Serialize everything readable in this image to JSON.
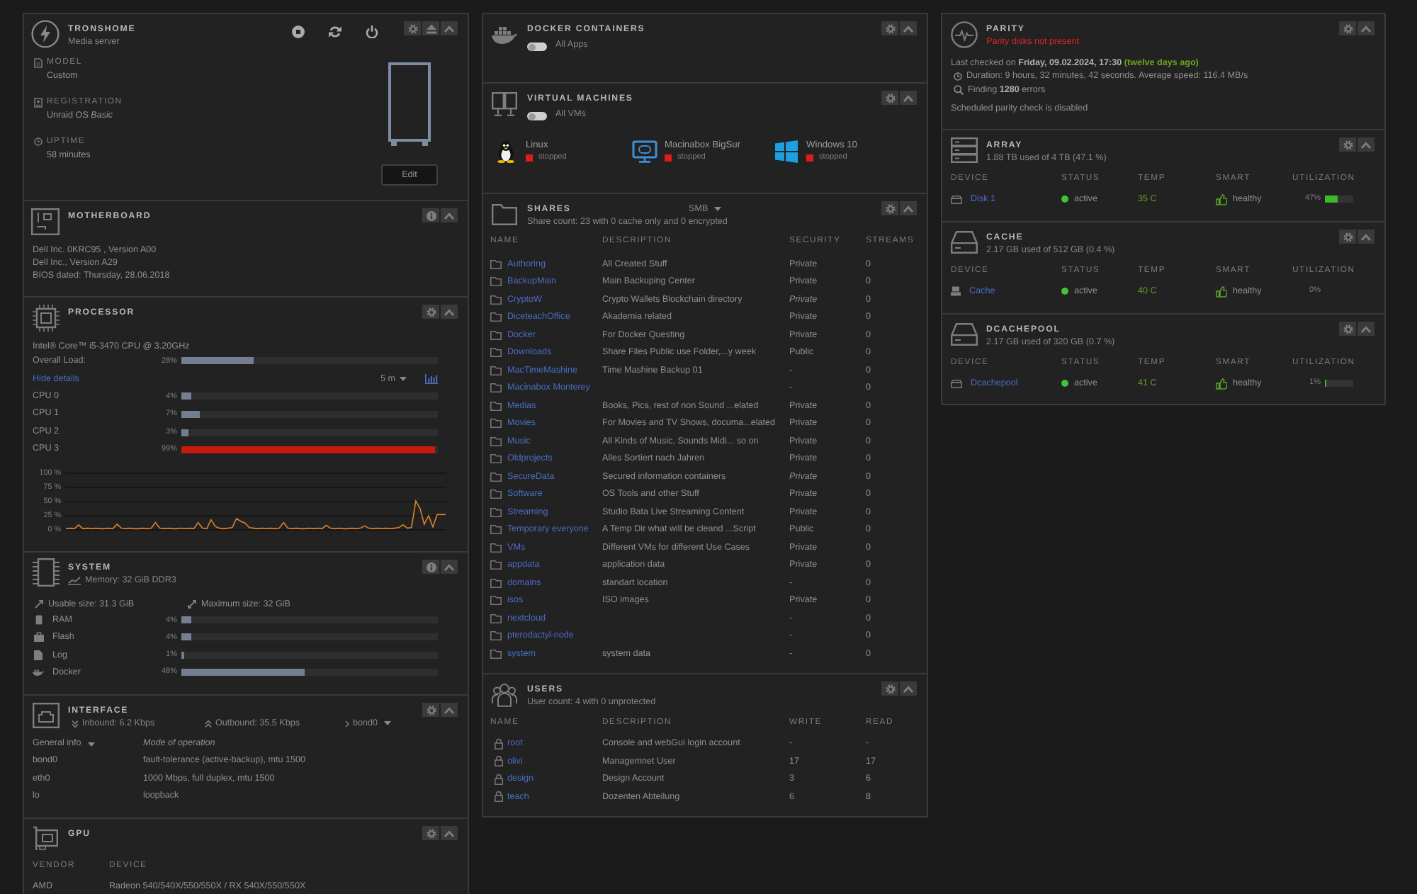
{
  "server": {
    "name": "TRONSHOME",
    "description": "Media server",
    "fields": [
      {
        "label": "MODEL",
        "value": "Custom"
      },
      {
        "label": "REGISTRATION",
        "value": "Unraid OS *Basic*"
      },
      {
        "label": "UPTIME",
        "value": "58 minutes"
      }
    ],
    "edit_button": "Edit"
  },
  "motherboard": {
    "title": "MOTHERBOARD",
    "lines": [
      "Dell Inc. 0KRC95 , Version A00",
      "Dell Inc., Version A29",
      "BIOS dated: Thursday, 28.06.2018"
    ]
  },
  "processor": {
    "title": "PROCESSOR",
    "model": "Intel® Core™ i5-3470 CPU @ 3.20GHz",
    "overall": {
      "label": "Overall Load:",
      "reading": "28%",
      "level": 0.28
    },
    "details_link": "Hide details",
    "interval": "5 m",
    "cores": [
      {
        "label": "CPU 0",
        "reading": "4%",
        "level": 0.04
      },
      {
        "label": "CPU 1",
        "reading": "7%",
        "level": 0.07
      },
      {
        "label": "CPU 2",
        "reading": "3%",
        "level": 0.03
      },
      {
        "label": "CPU 3",
        "reading": "99%",
        "level": 0.99
      }
    ],
    "chart_data": {
      "type": "line",
      "grid": true,
      "ylim": [
        0,
        100
      ],
      "yticks": [
        {
          "value": 100,
          "label": "100 %"
        },
        {
          "value": 75,
          "label": "75 %"
        },
        {
          "value": 50,
          "label": "50 %"
        },
        {
          "value": 25,
          "label": "25 %"
        },
        {
          "value": 0,
          "label": "0 %"
        }
      ],
      "series": [
        {
          "color": "#d9822b",
          "values": [
            2,
            3,
            2,
            9,
            2,
            3,
            2,
            3,
            2,
            2,
            3,
            2,
            10,
            3,
            2,
            3,
            2,
            2,
            3,
            2,
            3,
            13,
            3,
            2,
            3,
            2,
            2,
            3,
            2,
            3,
            2,
            13,
            3,
            2,
            18,
            6,
            3,
            2,
            3,
            4,
            20,
            15,
            12,
            4,
            3,
            2,
            3,
            2,
            3,
            2,
            3,
            13,
            3,
            2,
            3,
            2,
            2,
            3,
            2,
            3,
            2,
            8,
            3,
            2,
            3,
            2,
            2,
            3,
            2,
            3,
            7,
            3,
            2,
            3,
            2,
            3,
            2,
            3,
            4,
            9,
            3,
            4,
            51,
            38,
            10,
            25,
            5,
            27,
            27,
            27
          ]
        }
      ]
    }
  },
  "system": {
    "title": "SYSTEM",
    "memory": "Memory: 32 GiB DDR3",
    "usable": "Usable size: 31.3 GiB",
    "maximum": "Maximum size: 32 GiB",
    "usage": [
      {
        "label": "RAM",
        "reading": "4%",
        "level": 0.04
      },
      {
        "label": "Flash",
        "reading": "4%",
        "level": 0.04
      },
      {
        "label": "Log",
        "reading": "1%",
        "level": 0.01
      },
      {
        "label": "Docker",
        "reading": "48%",
        "level": 0.48
      }
    ]
  },
  "interface": {
    "title": "INTERFACE",
    "inbound": "Inbound: 6.2 Kbps",
    "outbound": "Outbound: 35.5 Kbps",
    "port": "bond0",
    "info_label": "General info",
    "info_heading": "Mode of operation",
    "rows": [
      {
        "name": "bond0",
        "value": "fault-tolerance (active-backup), mtu 1500"
      },
      {
        "name": "eth0",
        "value": "1000 Mbps, full duplex, mtu 1500"
      },
      {
        "name": "lo",
        "value": "loopback"
      }
    ]
  },
  "gpu": {
    "title": "GPU",
    "columns": [
      "VENDOR",
      "DEVICE"
    ],
    "rows": [
      {
        "vendor": "AMD",
        "device": "Radeon 540/540X/550/550X / RX 540X/550/550X"
      }
    ]
  },
  "docker": {
    "title": "DOCKER CONTAINERS",
    "toggle": {
      "label": "All Apps",
      "on": false
    }
  },
  "vms": {
    "title": "VIRTUAL MACHINES",
    "toggle": {
      "label": "All VMs",
      "on": false
    },
    "items": [
      {
        "name": "Linux",
        "kind": "linux",
        "status": "stopped",
        "running": false
      },
      {
        "name": "Macinabox BigSur",
        "kind": "mac",
        "status": "stopped",
        "running": false
      },
      {
        "name": "Windows 10",
        "kind": "windows",
        "status": "stopped",
        "running": false
      }
    ]
  },
  "shares": {
    "title": "SHARES",
    "protocol": "SMB",
    "summary": "Share count: 23 with 0 cache only and 0 encrypted",
    "columns": [
      "NAME",
      "DESCRIPTION",
      "SECURITY",
      "STREAMS"
    ],
    "rows": [
      {
        "name": "Authoring",
        "description": "All Created Stuff",
        "security": "Private",
        "security_italic": false,
        "streams": "0"
      },
      {
        "name": "BackupMain",
        "description": "Main Backuping Center",
        "security": "Private",
        "security_italic": false,
        "streams": "0"
      },
      {
        "name": "CryptoW",
        "description": "Crypto Wallets Blockchain directory",
        "security": "Private",
        "security_italic": true,
        "streams": "0"
      },
      {
        "name": "DiceteachOffice",
        "description": "Akademia related",
        "security": "Private",
        "security_italic": false,
        "streams": "0"
      },
      {
        "name": "Docker",
        "description": "For Docker Questing",
        "security": "Private",
        "security_italic": false,
        "streams": "0"
      },
      {
        "name": "Downloads",
        "description": "Share Files Public use Folder,...y week",
        "security": "Public",
        "security_italic": false,
        "streams": "0"
      },
      {
        "name": "MacTimeMashine",
        "description": "Time Mashine Backup 01",
        "security": "-",
        "security_italic": false,
        "streams": "0"
      },
      {
        "name": "Macinabox Monterey",
        "security": "-",
        "security_italic": false,
        "streams": "0"
      },
      {
        "name": "Medias",
        "description": "Books, Pics, rest of non Sound ...elated",
        "security": "Private",
        "security_italic": false,
        "streams": "0"
      },
      {
        "name": "Movies",
        "description": "For Movies and TV Shows, documa...elated",
        "security": "Private",
        "security_italic": false,
        "streams": "0"
      },
      {
        "name": "Music",
        "description": "All Kinds of Music, Sounds Midi... so on",
        "security": "Private",
        "security_italic": false,
        "streams": "0"
      },
      {
        "name": "Oldprojects",
        "description": "Alles Sortiert nach Jahren",
        "security": "Private",
        "security_italic": false,
        "streams": "0"
      },
      {
        "name": "SecureData",
        "description": "Secured information containers",
        "security": "Private",
        "security_italic": true,
        "streams": "0"
      },
      {
        "name": "Software",
        "description": "OS Tools and other Stuff",
        "security": "Private",
        "security_italic": false,
        "streams": "0"
      },
      {
        "name": "Streaming",
        "description": "Studio Bata Live Streaming Content",
        "security": "Private",
        "security_italic": false,
        "streams": "0"
      },
      {
        "name": "Temporary everyone",
        "description": "A Temp Dir what will be cleand ...Script",
        "security": "Public",
        "security_italic": false,
        "streams": "0"
      },
      {
        "name": "VMs",
        "description": "Different VMs for different Use Cases",
        "security": "Private",
        "security_italic": false,
        "streams": "0"
      },
      {
        "name": "appdata",
        "description": "application data",
        "security": "Private",
        "security_italic": false,
        "streams": "0"
      },
      {
        "name": "domains",
        "description": "standart location",
        "security": "-",
        "security_italic": false,
        "streams": "0"
      },
      {
        "name": "isos",
        "description": "ISO images",
        "security": "Private",
        "security_italic": false,
        "streams": "0"
      },
      {
        "name": "nextcloud",
        "security": "-",
        "security_italic": false,
        "streams": "0"
      },
      {
        "name": "pterodactyl-node",
        "security": "-",
        "security_italic": false,
        "streams": "0"
      },
      {
        "name": "system",
        "description": "system data",
        "security": "-",
        "security_italic": false,
        "streams": "0"
      }
    ]
  },
  "users": {
    "title": "USERS",
    "summary": "User count: 4 with 0 unprotected",
    "columns": [
      "NAME",
      "DESCRIPTION",
      "WRITE",
      "READ"
    ],
    "rows": [
      {
        "name": "root",
        "description": "Console and webGui login account",
        "write": "-",
        "read": "-"
      },
      {
        "name": "olivi",
        "description": "Managemnet User",
        "write": "17",
        "read": "17"
      },
      {
        "name": "design",
        "description": "Design Account",
        "write": "3",
        "read": "6"
      },
      {
        "name": "teach",
        "description": "Dozenten Abteilung",
        "write": "6",
        "read": "8"
      }
    ]
  },
  "parity": {
    "title": "PARITY",
    "status": "Parity disks not present",
    "last_checked": {
      "text": "Last checked on",
      "date": "Friday, 09.02.2024, 17:30",
      "age": "(twelve days ago)"
    },
    "duration": "Duration: 9 hours, 32 minutes, 42 seconds. Average speed: 116.4 MB/s",
    "errors": "Finding **1280** errors",
    "schedule": "Scheduled parity check is disabled"
  },
  "pools": [
    {
      "title": "ARRAY",
      "usage": "1.88 TB used of 4 TB (47.1 %)",
      "columns": [
        "DEVICE",
        "STATUS",
        "TEMP",
        "SMART",
        "UTILIZATION"
      ],
      "devices": [
        {
          "name": "Disk 1",
          "online": true,
          "status": "active",
          "temp": "35 C",
          "smart": "healthy",
          "reading": "47%",
          "level": 0.47
        }
      ]
    },
    {
      "title": "CACHE",
      "usage": "2.17 GB used of 512 GB (0.4 %)",
      "columns": [
        "DEVICE",
        "STATUS",
        "TEMP",
        "SMART",
        "UTILIZATION"
      ],
      "devices": [
        {
          "name": "Cache",
          "online": true,
          "status": "active",
          "temp": "40 C",
          "smart": "healthy",
          "reading": "0%"
        }
      ]
    },
    {
      "title": "DCACHEPOOL",
      "usage": "2.17 GB used of 320 GB (0.7 %)",
      "columns": [
        "DEVICE",
        "STATUS",
        "TEMP",
        "SMART",
        "UTILIZATION"
      ],
      "devices": [
        {
          "name": "Dcachepool",
          "online": true,
          "status": "active",
          "temp": "41 C",
          "smart": "healthy",
          "reading": "1%",
          "level": 0.01
        }
      ]
    }
  ]
}
